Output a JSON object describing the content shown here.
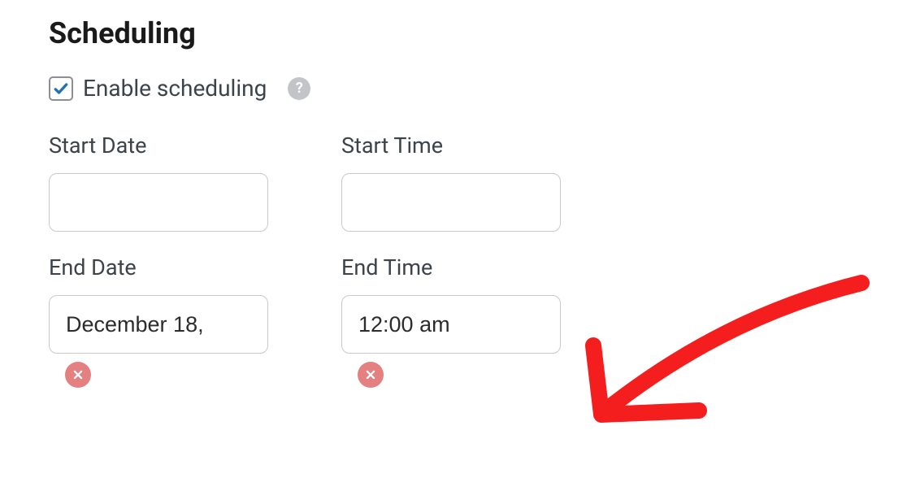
{
  "section": {
    "title": "Scheduling"
  },
  "enable": {
    "label": "Enable scheduling",
    "checked": true
  },
  "fields": {
    "start_date": {
      "label": "Start Date",
      "value": ""
    },
    "start_time": {
      "label": "Start Time",
      "value": ""
    },
    "end_date": {
      "label": "End Date",
      "value": "December 18,"
    },
    "end_time": {
      "label": "End Time",
      "value": "12:00 am"
    }
  },
  "colors": {
    "check": "#2271b1",
    "annotation": "#f41e1e"
  }
}
